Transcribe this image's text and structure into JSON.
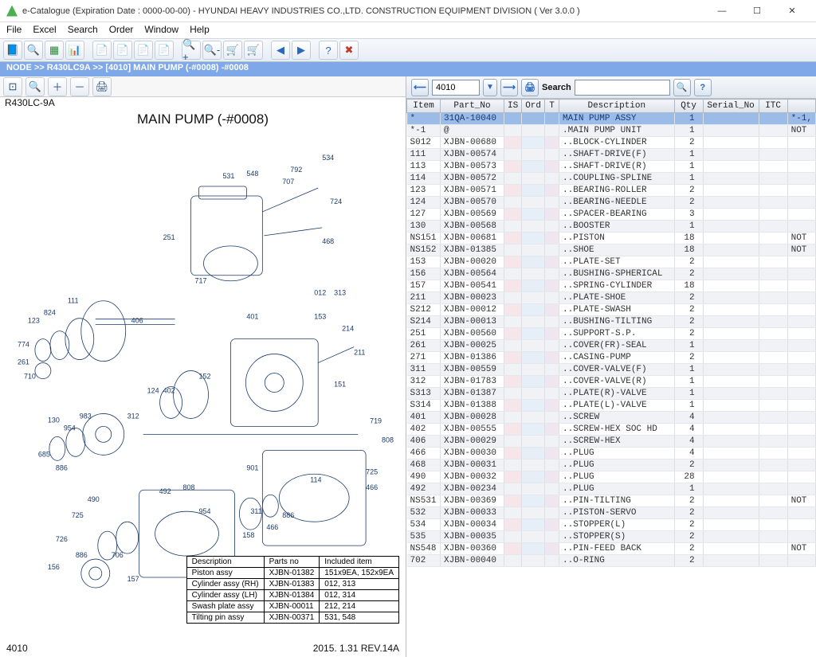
{
  "title": "e-Catalogue (Expiration Date : 0000-00-00)  -  HYUNDAI HEAVY INDUSTRIES CO.,LTD. CONSTRUCTION EQUIPMENT DIVISION ( Ver 3.0.0 )",
  "menu": [
    "File",
    "Excel",
    "Search",
    "Order",
    "Window",
    "Help"
  ],
  "breadcrumb": "NODE >> R430LC9A >> [4010] MAIN PUMP (-#0008)   -#0008",
  "model": "R430LC-9A",
  "drawing_title": "MAIN PUMP (-#0008)",
  "drawing_callouts": [
    "534",
    "548",
    "531",
    "792",
    "707",
    "724",
    "468",
    "251",
    "717",
    "111",
    "824",
    "123",
    "774",
    "261",
    "710",
    "406",
    "401",
    "012",
    "313",
    "153",
    "214",
    "211",
    "151",
    "152",
    "402",
    "124",
    "130",
    "954",
    "983",
    "312",
    "685",
    "886",
    "719",
    "725",
    "466",
    "114",
    "808",
    "808",
    "954",
    "490",
    "725",
    "726",
    "886",
    "156",
    "157",
    "158",
    "466",
    "886",
    "706",
    "901",
    "311",
    "492"
  ],
  "legend_header": [
    "Description",
    "Parts no",
    "Included item"
  ],
  "legend_rows": [
    [
      "Piston assy",
      "XJBN-01382",
      "151x9EA, 152x9EA"
    ],
    [
      "Cylinder assy (RH)",
      "XJBN-01383",
      "012, 313"
    ],
    [
      "Cylinder assy (LH)",
      "XJBN-01384",
      "012, 314"
    ],
    [
      "Swash plate assy",
      "XJBN-00011",
      "212, 214"
    ],
    [
      "Tilting pin assy",
      "XJBN-00371",
      "531, 548"
    ]
  ],
  "footer_left": "4010",
  "footer_right": "2015. 1.31  REV.14A",
  "right": {
    "figno": "4010",
    "search_label": "Search",
    "search_value": ""
  },
  "columns": [
    "Item",
    "Part_No",
    "IS",
    "Ord",
    "T",
    "Description",
    "Qty",
    "Serial_No",
    "ITC",
    ""
  ],
  "rows": [
    {
      "item": "*",
      "part": "31QA-10040",
      "desc": "MAIN PUMP ASSY",
      "qty": "1",
      "itc": "",
      "x": "*-1,",
      "sel": true
    },
    {
      "item": "*-1",
      "part": "@",
      "desc": ".MAIN PUMP UNIT",
      "qty": "1",
      "itc": "",
      "x": "NOT"
    },
    {
      "item": "S012",
      "part": "XJBN-00680",
      "desc": "..BLOCK-CYLINDER",
      "qty": "2"
    },
    {
      "item": "111",
      "part": "XJBN-00574",
      "desc": "..SHAFT-DRIVE(F)",
      "qty": "1"
    },
    {
      "item": "113",
      "part": "XJBN-00573",
      "desc": "..SHAFT-DRIVE(R)",
      "qty": "1"
    },
    {
      "item": "114",
      "part": "XJBN-00572",
      "desc": "..COUPLING-SPLINE",
      "qty": "1"
    },
    {
      "item": "123",
      "part": "XJBN-00571",
      "desc": "..BEARING-ROLLER",
      "qty": "2"
    },
    {
      "item": "124",
      "part": "XJBN-00570",
      "desc": "..BEARING-NEEDLE",
      "qty": "2"
    },
    {
      "item": "127",
      "part": "XJBN-00569",
      "desc": "..SPACER-BEARING",
      "qty": "3"
    },
    {
      "item": "130",
      "part": "XJBN-00568",
      "desc": "..BOOSTER",
      "qty": "1"
    },
    {
      "item": "NS151",
      "part": "XJBN-00681",
      "desc": "..PISTON",
      "qty": "18",
      "x": "NOT"
    },
    {
      "item": "NS152",
      "part": "XJBN-01385",
      "desc": "..SHOE",
      "qty": "18",
      "x": "NOT"
    },
    {
      "item": "153",
      "part": "XJBN-00020",
      "desc": "..PLATE-SET",
      "qty": "2"
    },
    {
      "item": "156",
      "part": "XJBN-00564",
      "desc": "..BUSHING-SPHERICAL",
      "qty": "2"
    },
    {
      "item": "157",
      "part": "XJBN-00541",
      "desc": "..SPRING-CYLINDER",
      "qty": "18"
    },
    {
      "item": "211",
      "part": "XJBN-00023",
      "desc": "..PLATE-SHOE",
      "qty": "2"
    },
    {
      "item": "S212",
      "part": "XJBN-00012",
      "desc": "..PLATE-SWASH",
      "qty": "2"
    },
    {
      "item": "S214",
      "part": "XJBN-00013",
      "desc": "..BUSHING-TILTING",
      "qty": "2"
    },
    {
      "item": "251",
      "part": "XJBN-00560",
      "desc": "..SUPPORT-S.P.",
      "qty": "2"
    },
    {
      "item": "261",
      "part": "XJBN-00025",
      "desc": "..COVER(FR)-SEAL",
      "qty": "1"
    },
    {
      "item": "271",
      "part": "XJBN-01386",
      "desc": "..CASING-PUMP",
      "qty": "2"
    },
    {
      "item": "311",
      "part": "XJBN-00559",
      "desc": "..COVER-VALVE(F)",
      "qty": "1"
    },
    {
      "item": "312",
      "part": "XJBN-01783",
      "desc": "..COVER-VALVE(R)",
      "qty": "1"
    },
    {
      "item": "S313",
      "part": "XJBN-01387",
      "desc": "..PLATE(R)-VALVE",
      "qty": "1"
    },
    {
      "item": "S314",
      "part": "XJBN-01388",
      "desc": "..PLATE(L)-VALVE",
      "qty": "1"
    },
    {
      "item": "401",
      "part": "XJBN-00028",
      "desc": "..SCREW",
      "qty": "4"
    },
    {
      "item": "402",
      "part": "XJBN-00555",
      "desc": "..SCREW-HEX SOC HD",
      "qty": "4"
    },
    {
      "item": "406",
      "part": "XJBN-00029",
      "desc": "..SCREW-HEX",
      "qty": "4"
    },
    {
      "item": "466",
      "part": "XJBN-00030",
      "desc": "..PLUG",
      "qty": "4"
    },
    {
      "item": "468",
      "part": "XJBN-00031",
      "desc": "..PLUG",
      "qty": "2"
    },
    {
      "item": "490",
      "part": "XJBN-00032",
      "desc": "..PLUG",
      "qty": "28"
    },
    {
      "item": "492",
      "part": "XJBN-00234",
      "desc": "..PLUG",
      "qty": "1"
    },
    {
      "item": "NS531",
      "part": "XJBN-00369",
      "desc": "..PIN-TILTING",
      "qty": "2",
      "x": "NOT"
    },
    {
      "item": "532",
      "part": "XJBN-00033",
      "desc": "..PISTON-SERVO",
      "qty": "2"
    },
    {
      "item": "534",
      "part": "XJBN-00034",
      "desc": "..STOPPER(L)",
      "qty": "2"
    },
    {
      "item": "535",
      "part": "XJBN-00035",
      "desc": "..STOPPER(S)",
      "qty": "2"
    },
    {
      "item": "NS548",
      "part": "XJBN-00360",
      "desc": "..PIN-FEED BACK",
      "qty": "2",
      "x": "NOT"
    },
    {
      "item": "702",
      "part": "XJBN-00040",
      "desc": "..O-RING",
      "qty": "2"
    }
  ]
}
